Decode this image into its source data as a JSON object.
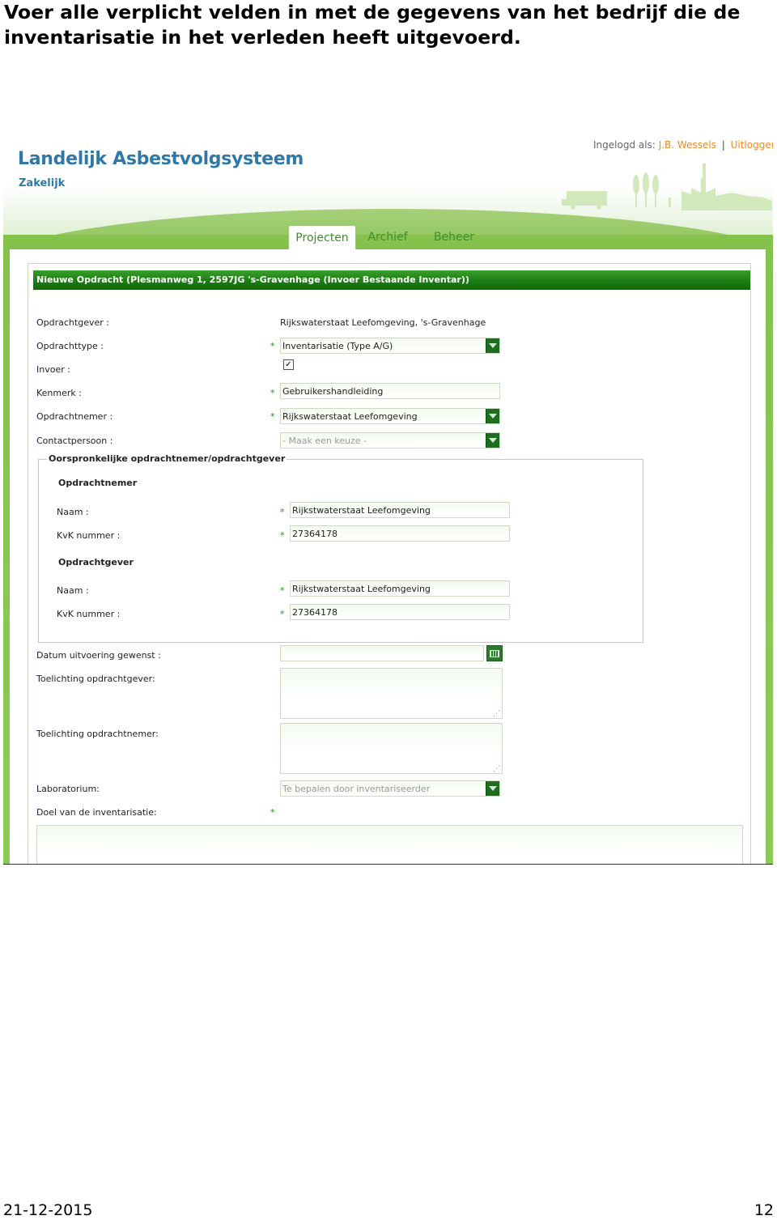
{
  "document": {
    "instruction": "Voer alle verplicht velden in met de gegevens van het bedrijf die de inventarisatie in het verleden heeft uitgevoerd.",
    "footer_date": "21-12-2015",
    "page_number": "12"
  },
  "app": {
    "title": "Landelijk Asbestvolgsysteem",
    "subtitle": "Zakelijk",
    "login_prefix": "Ingelogd als:",
    "user": "J.B. Wessels",
    "separator": "|",
    "logout": "Uitloggen"
  },
  "tabs": [
    {
      "label": "Projecten",
      "active": true
    },
    {
      "label": "Archief",
      "active": false
    },
    {
      "label": "Beheer",
      "active": false
    }
  ],
  "form": {
    "panel_title": "Nieuwe Opdracht (Plesmanweg 1, 2597JG 's-Gravenhage (Invoer Bestaande Inventar))",
    "required_marker": "*",
    "opdrachtgever_label": "Opdrachtgever :",
    "opdrachtgever_value": "Rijkswaterstaat Leefomgeving, 's-Gravenhage",
    "opdrachttype_label": "Opdrachttype :",
    "opdrachttype_value": "Inventarisatie (Type A/G)",
    "invoer_label": "Invoer :",
    "invoer_checked": true,
    "kenmerk_label": "Kenmerk :",
    "kenmerk_value": "Gebruikershandleiding",
    "opdrachtnemer_label": "Opdrachtnemer :",
    "opdrachtnemer_value": "Rijkswaterstaat Leefomgeving",
    "contactpersoon_label": "Contactpersoon :",
    "contactpersoon_placeholder": "- Maak een keuze -",
    "original_legend": "Oorspronkelijke opdrachtnemer/opdrachtgever",
    "orig_opdrachtnemer_heading": "Opdrachtnemer",
    "orig_opdrachtnemer_naam_label": "Naam :",
    "orig_opdrachtnemer_naam": "Rijkstwaterstaat Leefomgeving",
    "orig_opdrachtnemer_kvk_label": "KvK nummer :",
    "orig_opdrachtnemer_kvk": "27364178",
    "orig_opdrachtgever_heading": "Opdrachtgever",
    "orig_opdrachtgever_naam_label": "Naam :",
    "orig_opdrachtgever_naam": "Rijkstwaterstaat Leefomgeving",
    "orig_opdrachtgever_kvk_label": "KvK nummer :",
    "orig_opdrachtgever_kvk": "27364178",
    "datum_label": "Datum uitvoering gewenst :",
    "datum_value": "",
    "toelichting_gever_label": "Toelichting opdrachtgever:",
    "toelichting_nemer_label": "Toelichting opdrachtnemer:",
    "laboratorium_label": "Laboratorium:",
    "laboratorium_placeholder": "Te bepalen door inventariseerder",
    "doel_label": "Doel van de inventarisatie:"
  },
  "colors": {
    "brand_blue": "#2f78a8",
    "accent_orange": "#f08a1c",
    "green_dark": "#1f7f16",
    "green_band": "#84c24c"
  }
}
